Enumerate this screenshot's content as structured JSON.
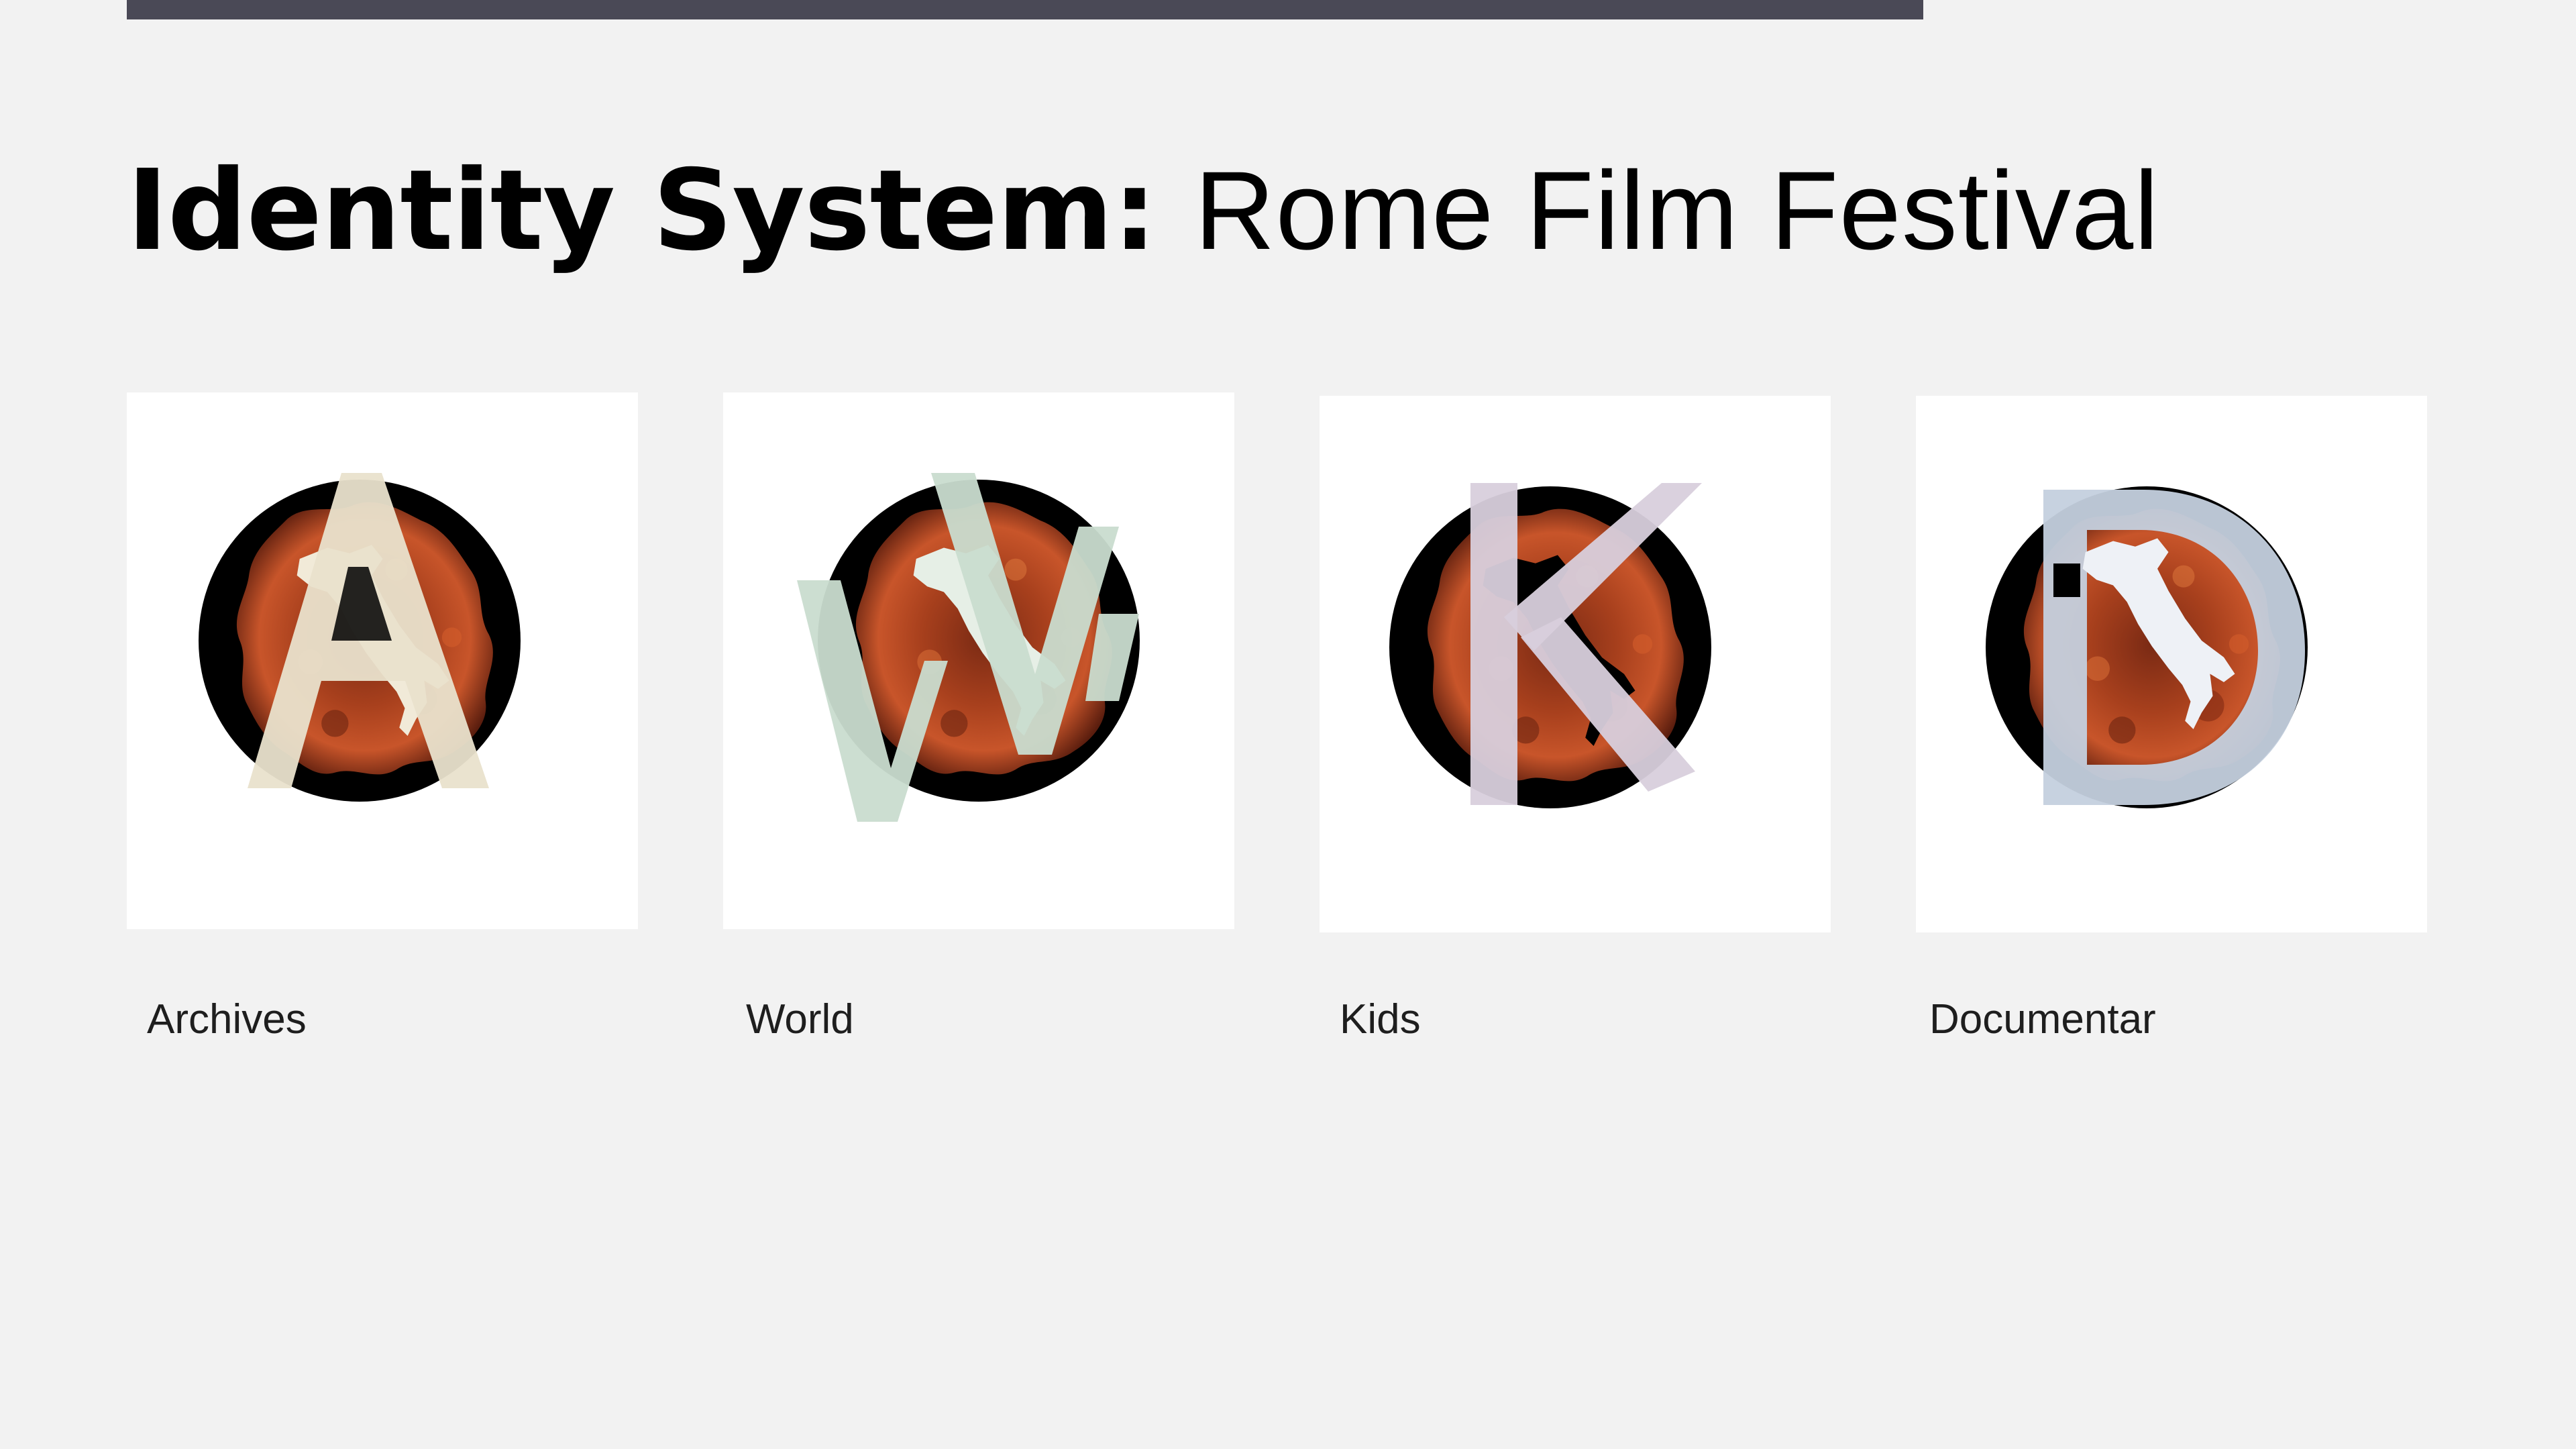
{
  "title": {
    "bold": "Identity System:",
    "light": "Rome Film Festival"
  },
  "colors": {
    "background": "#f2f2f2",
    "top_bar": "#4a4956",
    "card": "#ffffff",
    "disc": "#000000",
    "fire": "#b8431c"
  },
  "cards": [
    {
      "label": "Archives",
      "letter_icon": "letter-a-icon",
      "letter_color": "#e9e2cc"
    },
    {
      "label": "World",
      "letter_icon": "letter-w-icon",
      "letter_color": "#c9dccf"
    },
    {
      "label": "Kids",
      "letter_icon": "letter-k-icon",
      "letter_color": "#d8cfdc"
    },
    {
      "label": "Documentar",
      "letter_icon": "letter-d-icon",
      "letter_color": "#c4d0de"
    }
  ]
}
